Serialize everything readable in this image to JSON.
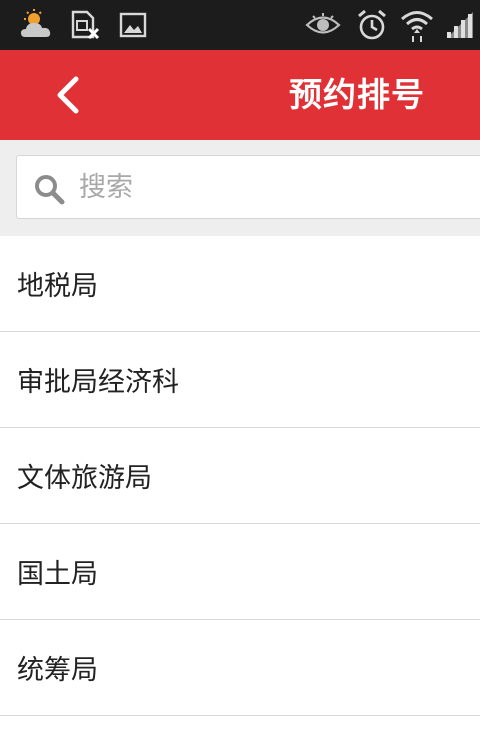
{
  "status_bar": {
    "icons": [
      "weather-partly-cloudy-icon",
      "sim-error-icon",
      "image-icon",
      "eye-icon",
      "alarm-icon",
      "wifi-icon",
      "signal-icon"
    ]
  },
  "app_bar": {
    "title": "预约排号",
    "back_icon": "chevron-left-icon",
    "color": "#e03236"
  },
  "search": {
    "placeholder": "搜索",
    "value": ""
  },
  "list": {
    "items": [
      {
        "label": "地税局"
      },
      {
        "label": "审批局经济科"
      },
      {
        "label": "文体旅游局"
      },
      {
        "label": "国土局"
      },
      {
        "label": "统筹局"
      }
    ]
  }
}
